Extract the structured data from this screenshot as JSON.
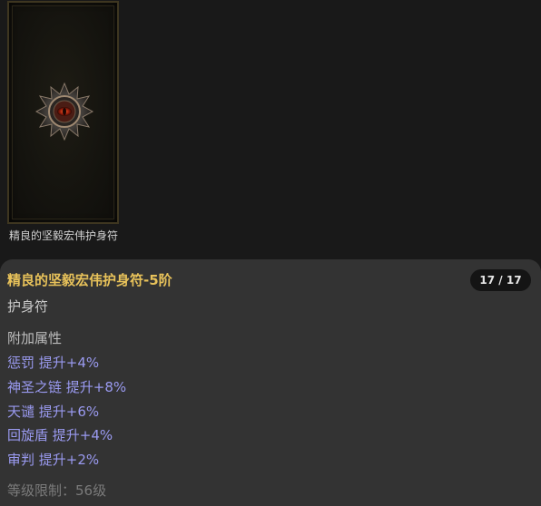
{
  "item_card": {
    "caption": "精良的坚毅宏伟护身符",
    "image_icon": "amulet-icon"
  },
  "tooltip": {
    "title": "精良的坚毅宏伟护身符-5阶",
    "counter": "17 / 17",
    "type": "护身符",
    "section_label": "附加属性",
    "affixes": [
      "惩罚 提升+4%",
      "神圣之链 提升+8%",
      "天谴 提升+6%",
      "回旋盾 提升+4%",
      "审判 提升+2%"
    ],
    "requirement": "等级限制：56级"
  },
  "colors": {
    "title": "#e8c25a",
    "affix": "#9a9af0",
    "requirement": "#7b7b7b",
    "panel_bg": "#333333"
  }
}
